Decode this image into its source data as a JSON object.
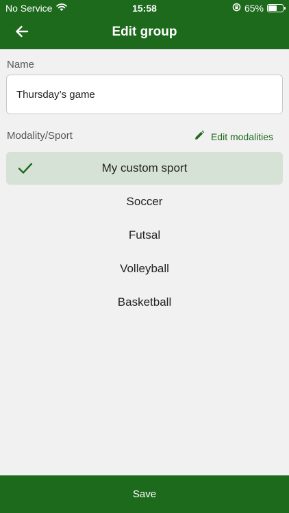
{
  "status_bar": {
    "carrier": "No Service",
    "time": "15:58",
    "battery_percent": "65%",
    "battery_level": 0.65
  },
  "header": {
    "title": "Edit group",
    "back_icon": "arrow-left-icon"
  },
  "form": {
    "name_label": "Name",
    "name_value": "Thursday’s game",
    "modality_label": "Modality/Sport",
    "edit_modalities_label": "Edit modalities"
  },
  "sports": [
    {
      "label": "My custom sport",
      "selected": true
    },
    {
      "label": "Soccer",
      "selected": false
    },
    {
      "label": "Futsal",
      "selected": false
    },
    {
      "label": "Volleyball",
      "selected": false
    },
    {
      "label": "Basketball",
      "selected": false
    }
  ],
  "footer": {
    "save_label": "Save"
  },
  "colors": {
    "primary": "#1d6a1d",
    "selected_bg": "#d7e2d6",
    "background": "#f1f1f1"
  }
}
